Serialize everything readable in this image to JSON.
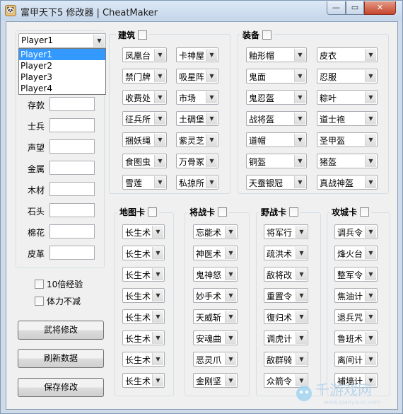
{
  "window": {
    "title": "富甲天下5 修改器 | CheatMaker",
    "app_icon": "🐼",
    "min": "—",
    "max": "▭",
    "close": "✕"
  },
  "player": {
    "selected": "Player1",
    "options": [
      "Player1",
      "Player2",
      "Player3",
      "Player4"
    ]
  },
  "stats": [
    {
      "label": "存款",
      "value": ""
    },
    {
      "label": "士兵",
      "value": ""
    },
    {
      "label": "声望",
      "value": ""
    },
    {
      "label": "金属",
      "value": ""
    },
    {
      "label": "木材",
      "value": ""
    },
    {
      "label": "石头",
      "value": ""
    },
    {
      "label": "棉花",
      "value": ""
    },
    {
      "label": "皮革",
      "value": ""
    }
  ],
  "options": {
    "exp10x": "10倍经验",
    "stamina": "体力不减"
  },
  "buttons": {
    "general": "武将修改",
    "refresh": "刷新数据",
    "save": "保存修改"
  },
  "buildings": {
    "title": "建筑",
    "col1": [
      "凤凰台",
      "禁门牌",
      "收费处",
      "征兵所",
      "捆妖绳",
      "食图虫",
      "雪莲"
    ],
    "col2": [
      "卡神屋",
      "吸星阵",
      "市场",
      "土碉堡",
      "紫灵芝",
      "万骨冢",
      "私掠所"
    ]
  },
  "equipment": {
    "title": "装备",
    "col1": [
      "釉形帽",
      "鬼面",
      "鬼忍盔",
      "战将盔",
      "道帽",
      "铜盔",
      "天蚕银冠"
    ],
    "col2": [
      "皮衣",
      "忍服",
      "粽叶",
      "道士袍",
      "圣甲盔",
      "猪盔",
      "真战神盔"
    ]
  },
  "map_cards": {
    "title": "地图卡",
    "items": [
      "长生术",
      "长生术",
      "长生术",
      "长生术",
      "长生术",
      "长生术",
      "长生术",
      "长生术"
    ]
  },
  "general_cards": {
    "title": "将战卡",
    "items": [
      "忘能术",
      "神医术",
      "鬼神怒",
      "妙手术",
      "天威斩",
      "安魂曲",
      "恶灵爪",
      "金刚坚"
    ]
  },
  "field_cards": {
    "title": "野战卡",
    "items": [
      "将军行",
      "疏洪术",
      "敌将改",
      "重置令",
      "復归术",
      "调虎计",
      "敌群骑",
      "众箭令"
    ]
  },
  "siege_cards": {
    "title": "攻城卡",
    "items": [
      "调兵令",
      "烽火台",
      "整军令",
      "焦油计",
      "退兵咒",
      "鲁班术",
      "离间计",
      "補墙计"
    ]
  },
  "watermark": {
    "text": "千游戏网",
    "url": "www.qianyouxi.com"
  }
}
